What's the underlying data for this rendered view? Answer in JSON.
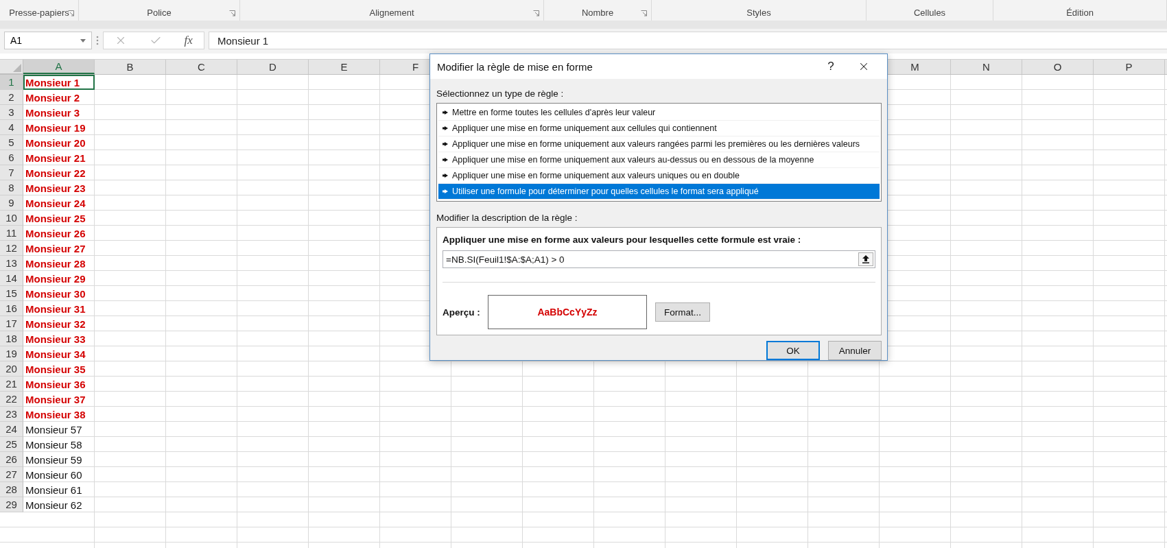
{
  "ribbon": {
    "groups": [
      {
        "label": "Presse-papiers",
        "launcher": true
      },
      {
        "label": "Police",
        "launcher": true
      },
      {
        "label": "Alignement",
        "launcher": true
      },
      {
        "label": "Nombre",
        "launcher": true
      },
      {
        "label": "Styles",
        "launcher": false
      },
      {
        "label": "Cellules",
        "launcher": false
      },
      {
        "label": "Édition",
        "launcher": false
      }
    ]
  },
  "formula_bar": {
    "name_box": "A1",
    "function_label": "fx",
    "value": "Monsieur 1"
  },
  "sheet": {
    "columns": [
      {
        "label": "A",
        "selected": true
      },
      {
        "label": "B",
        "selected": false
      },
      {
        "label": "C",
        "selected": false
      },
      {
        "label": "D",
        "selected": false
      },
      {
        "label": "E",
        "selected": false
      },
      {
        "label": "F",
        "selected": false
      },
      {
        "label": "M",
        "selected": false
      },
      {
        "label": "N",
        "selected": false
      },
      {
        "label": "O",
        "selected": false
      },
      {
        "label": "P",
        "selected": false
      }
    ],
    "rows": [
      {
        "number": "1",
        "value": "Monsieur 1",
        "highlighted": true,
        "selected": true
      },
      {
        "number": "2",
        "value": "Monsieur 2",
        "highlighted": true,
        "selected": false
      },
      {
        "number": "3",
        "value": "Monsieur 3",
        "highlighted": true,
        "selected": false
      },
      {
        "number": "4",
        "value": "Monsieur 19",
        "highlighted": true,
        "selected": false
      },
      {
        "number": "5",
        "value": "Monsieur 20",
        "highlighted": true,
        "selected": false
      },
      {
        "number": "6",
        "value": "Monsieur 21",
        "highlighted": true,
        "selected": false
      },
      {
        "number": "7",
        "value": "Monsieur 22",
        "highlighted": true,
        "selected": false
      },
      {
        "number": "8",
        "value": "Monsieur 23",
        "highlighted": true,
        "selected": false
      },
      {
        "number": "9",
        "value": "Monsieur 24",
        "highlighted": true,
        "selected": false
      },
      {
        "number": "10",
        "value": "Monsieur 25",
        "highlighted": true,
        "selected": false
      },
      {
        "number": "11",
        "value": "Monsieur 26",
        "highlighted": true,
        "selected": false
      },
      {
        "number": "12",
        "value": "Monsieur 27",
        "highlighted": true,
        "selected": false
      },
      {
        "number": "13",
        "value": "Monsieur 28",
        "highlighted": true,
        "selected": false
      },
      {
        "number": "14",
        "value": "Monsieur 29",
        "highlighted": true,
        "selected": false
      },
      {
        "number": "15",
        "value": "Monsieur 30",
        "highlighted": true,
        "selected": false
      },
      {
        "number": "16",
        "value": "Monsieur 31",
        "highlighted": true,
        "selected": false
      },
      {
        "number": "17",
        "value": "Monsieur 32",
        "highlighted": true,
        "selected": false
      },
      {
        "number": "18",
        "value": "Monsieur 33",
        "highlighted": true,
        "selected": false
      },
      {
        "number": "19",
        "value": "Monsieur 34",
        "highlighted": true,
        "selected": false
      },
      {
        "number": "20",
        "value": "Monsieur 35",
        "highlighted": true,
        "selected": false
      },
      {
        "number": "21",
        "value": "Monsieur 36",
        "highlighted": true,
        "selected": false
      },
      {
        "number": "22",
        "value": "Monsieur 37",
        "highlighted": true,
        "selected": false
      },
      {
        "number": "23",
        "value": "Monsieur 38",
        "highlighted": true,
        "selected": false
      },
      {
        "number": "24",
        "value": "Monsieur 57",
        "highlighted": false,
        "selected": false
      },
      {
        "number": "25",
        "value": "Monsieur 58",
        "highlighted": false,
        "selected": false
      },
      {
        "number": "26",
        "value": "Monsieur 59",
        "highlighted": false,
        "selected": false
      },
      {
        "number": "27",
        "value": "Monsieur 60",
        "highlighted": false,
        "selected": false
      },
      {
        "number": "28",
        "value": "Monsieur 61",
        "highlighted": false,
        "selected": false
      },
      {
        "number": "29",
        "value": "Monsieur 62",
        "highlighted": false,
        "selected": false
      }
    ]
  },
  "dialog": {
    "title": "Modifier la règle de mise en forme",
    "help": "?",
    "rule_type_label": "Sélectionnez un type de règle :",
    "rule_types": [
      {
        "label": "Mettre en forme toutes les cellules d'après leur valeur",
        "selected": false
      },
      {
        "label": "Appliquer une mise en forme uniquement aux cellules qui contiennent",
        "selected": false
      },
      {
        "label": "Appliquer une mise en forme uniquement aux valeurs rangées parmi les premières ou les dernières valeurs",
        "selected": false
      },
      {
        "label": "Appliquer une mise en forme uniquement aux valeurs au-dessus ou en dessous de la moyenne",
        "selected": false
      },
      {
        "label": "Appliquer une mise en forme uniquement aux valeurs uniques ou en double",
        "selected": false
      },
      {
        "label": "Utiliser une formule pour déterminer pour quelles cellules le format sera appliqué",
        "selected": true
      }
    ],
    "description_label": "Modifier la description de la règle :",
    "formula_heading": "Appliquer une mise en forme aux valeurs pour lesquelles cette formule est vraie :",
    "formula": "=NB.SI(Feuil1!$A:$A;A1) > 0",
    "preview_label": "Aperçu :",
    "preview_text": "AaBbCcYyZz",
    "format_button": "Format...",
    "ok_button": "OK",
    "cancel_button": "Annuler"
  }
}
